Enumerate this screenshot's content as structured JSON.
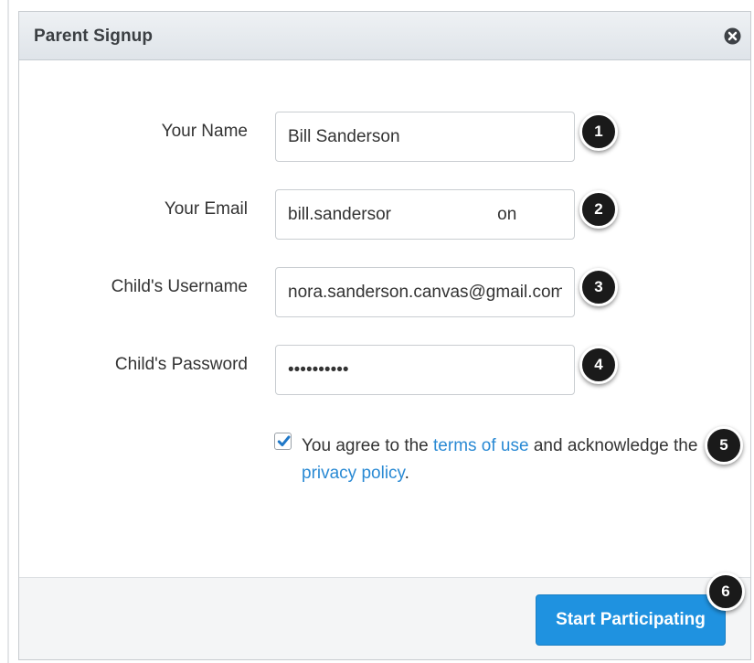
{
  "dialog": {
    "title": "Parent Signup",
    "close_icon": "close-circle-icon"
  },
  "form": {
    "fields": [
      {
        "label": "Your Name",
        "value": "Bill Sanderson",
        "callout": "1"
      },
      {
        "label": "Your Email",
        "value": "bill.sandersor                      on",
        "callout": "2"
      },
      {
        "label": "Child's Username",
        "value": "nora.sanderson.canvas@gmail.com",
        "callout": "3"
      },
      {
        "label": "Child's Password",
        "value": "••••••••••",
        "callout": "4"
      }
    ],
    "agreement": {
      "checked": true,
      "text_before": "You agree to the ",
      "terms_link": "terms of use",
      "text_middle": " and acknowledge the ",
      "privacy_link": "privacy policy",
      "text_after": ".",
      "callout": "5"
    }
  },
  "footer": {
    "submit_label": "Start Participating",
    "callout": "6"
  },
  "colors": {
    "primary_button": "#1f92e0",
    "link": "#2a8ad4",
    "callout_bg": "#1a1a1a"
  }
}
